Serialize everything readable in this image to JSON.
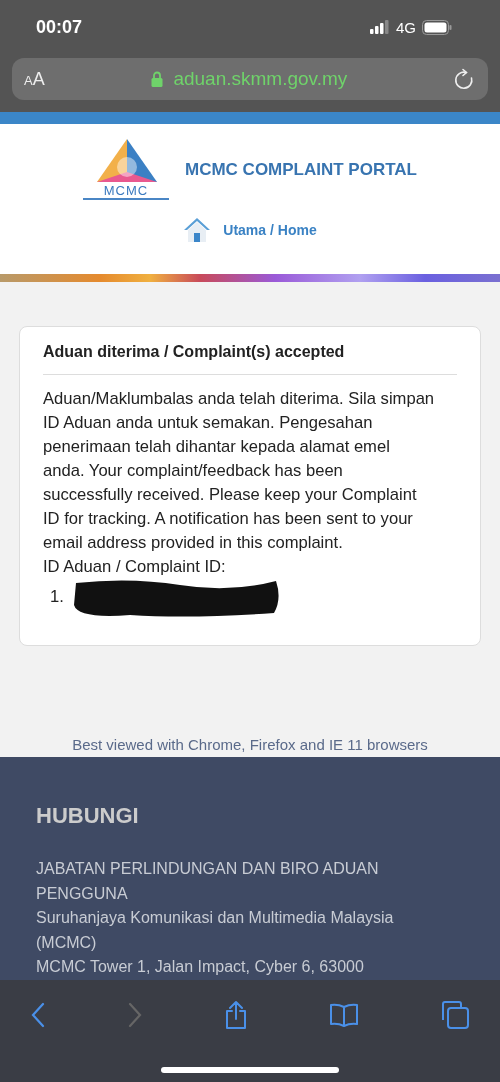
{
  "status_bar": {
    "time": "00:07",
    "network": "4G"
  },
  "address_bar": {
    "text_size": [
      "A",
      "A"
    ],
    "url": "aduan.skmm.gov.my",
    "secure": true
  },
  "header": {
    "title": "MCMC COMPLAINT PORTAL",
    "logo_text": "MCMC",
    "home_link": "Utama / Home"
  },
  "card": {
    "title": "Aduan diterima / Complaint(s) accepted",
    "message": "Aduan/Maklumbalas anda telah diterima. Sila simpan ID Aduan anda untuk semakan. Pengesahan penerimaan telah dihantar kepada alamat emel anda. Your complaint/feedback has been successfully received. Please keep your Complaint ID for tracking. A notification has been sent to your email address provided in this complaint.",
    "id_label": "ID Aduan / Complaint ID:",
    "ids": [
      {
        "number": "1.",
        "redacted": true
      }
    ]
  },
  "browser_note": "Best viewed with Chrome, Firefox and IE 11 browsers",
  "footer": {
    "heading": "HUBUNGI",
    "lines": [
      "JABATAN PERLINDUNGAN DAN BIRO ADUAN PENGGUNA",
      "Suruhanjaya Komunikasi dan Multimedia Malaysia (MCMC)",
      "MCMC Tower 1, Jalan Impact, Cyber 6, 63000"
    ]
  },
  "toolbar": [
    {
      "kind": "back",
      "disabled": false
    },
    {
      "kind": "forward",
      "disabled": true
    },
    {
      "kind": "share",
      "disabled": false
    },
    {
      "kind": "bookmarks",
      "disabled": false
    },
    {
      "kind": "tabs",
      "disabled": false
    }
  ]
}
